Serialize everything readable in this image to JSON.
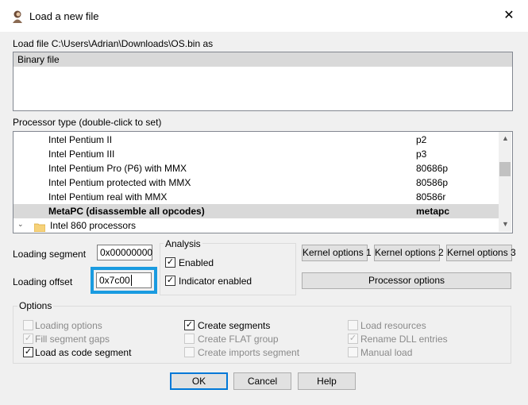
{
  "window": {
    "title": "Load a new file",
    "close_glyph": "✕"
  },
  "load_file_label": "Load file C:\\Users\\Adrian\\Downloads\\OS.bin as",
  "file_types": [
    "Binary file"
  ],
  "processor_label": "Processor type (double-click to set)",
  "processors": [
    {
      "name": "Intel Pentium II",
      "code": "p2"
    },
    {
      "name": "Intel Pentium III",
      "code": "p3"
    },
    {
      "name": "Intel Pentium Pro (P6) with MMX",
      "code": "80686p"
    },
    {
      "name": "Intel Pentium protected with MMX",
      "code": "80586p"
    },
    {
      "name": "Intel Pentium real with MMX",
      "code": "80586r"
    },
    {
      "name": "MetaPC (disassemble all opcodes)",
      "code": "metapc"
    },
    {
      "name": "Intel 860 processors",
      "code": ""
    }
  ],
  "loading": {
    "segment_label": "Loading segment",
    "segment_value": "0x00000000",
    "offset_label": "Loading offset",
    "offset_value": "0x7c00"
  },
  "analysis": {
    "title": "Analysis",
    "enabled_label": "Enabled",
    "indicator_label": "Indicator enabled"
  },
  "kernel_buttons": [
    "Kernel options 1",
    "Kernel options 2",
    "Kernel options 3"
  ],
  "processor_options_label": "Processor options",
  "options": {
    "title": "Options",
    "col1": [
      "Loading options",
      "Fill segment gaps",
      "Load as code segment"
    ],
    "col2": [
      "Create segments",
      "Create FLAT group",
      "Create imports segment"
    ],
    "col3": [
      "Load resources",
      "Rename DLL entries",
      "Manual load"
    ]
  },
  "buttons": {
    "ok": "OK",
    "cancel": "Cancel",
    "help": "Help"
  },
  "highlight_color": "#1a9be0"
}
